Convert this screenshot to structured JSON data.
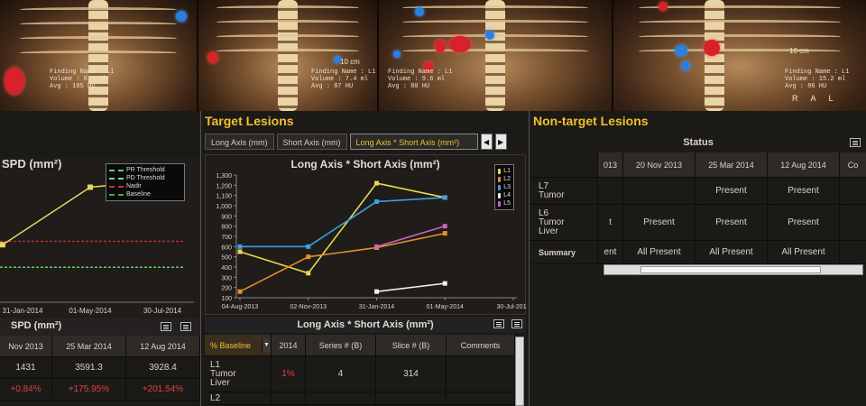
{
  "scans": [
    {
      "finding": "Finding Name : L1",
      "volume": "Volume : 6.5 ml",
      "avg": "Avg : 195 HU",
      "scale": "10 cm",
      "orient": "R A L"
    },
    {
      "finding": "Finding Name : L1",
      "volume": "Volume : 7.4 ml",
      "avg": "Avg : 87 HU",
      "scale": "10 cm",
      "orient": "R A L"
    },
    {
      "finding": "Finding Name : L1",
      "volume": "Volume : 9.6 ml",
      "avg": "Avg : 80 HU",
      "scale": "10 cm",
      "orient": "R A L"
    },
    {
      "finding": "Finding Name : L1",
      "volume": "Volume : 15.2 ml",
      "avg": "Avg : 86 HU",
      "scale": "10 cm",
      "orient": "R A L"
    }
  ],
  "left_panel": {
    "chart_title": "SPD (mm²)",
    "legend": [
      "PR Threshold",
      "PD Threshold",
      "Nadir",
      "Baseline"
    ],
    "x_ticks": [
      "31-Jan-2014",
      "01-May-2014",
      "30-Jul-2014"
    ],
    "table_title": "SPD (mm²)",
    "headers": [
      "Nov 2013",
      "25 Mar 2014",
      "12 Aug 2014"
    ],
    "row_values": [
      "1431",
      "3591.3",
      "3928.4"
    ],
    "row_pct": [
      "+0.84%",
      "+175.95%",
      "+201.54%"
    ]
  },
  "mid_panel": {
    "title": "Target Lesions",
    "tabs": [
      "Long Axis (mm)",
      "Short Axis (mm)",
      "Long Axis * Short Axis (mm²)"
    ],
    "subbar_title": "Long Axis * Short Axis (mm²)",
    "table_headers": [
      "% Baseline",
      "2014",
      "Series # (B)",
      "Slice # (B)",
      "Comments"
    ],
    "row1": {
      "label": "L1\nTumor\nLiver",
      "pct": "1%",
      "series": "4",
      "slice": "314"
    },
    "row2_label": "L2"
  },
  "right_panel": {
    "title": "Non-target Lesions",
    "status_label": "Status",
    "headers": [
      "013",
      "20 Nov 2013",
      "25 Mar 2014",
      "12 Aug 2014",
      "Co"
    ],
    "rows": [
      {
        "label": "L7\nTumor",
        "values": [
          "",
          "",
          "Present",
          "Present",
          ""
        ]
      },
      {
        "label": "L6\nTumor\nLiver",
        "values": [
          "t",
          "Present",
          "Present",
          "Present",
          ""
        ]
      },
      {
        "label": "Summary",
        "values": [
          "ent",
          "All Present",
          "All Present",
          "All Present",
          ""
        ]
      }
    ]
  },
  "chart_data": [
    {
      "type": "line",
      "title": "SPD (mm²)",
      "x": [
        "31-Jan-2014",
        "01-May-2014",
        "30-Jul-2014"
      ],
      "series": [
        {
          "name": "Baseline",
          "color": "#6c6",
          "values": [
            [
              0,
              310
            ],
            [
              1,
              310
            ],
            [
              2,
              310
            ]
          ]
        },
        {
          "name": "Nadir",
          "color": "#b03030",
          "values": [
            [
              0,
              540
            ],
            [
              1,
              540
            ],
            [
              2,
              540
            ]
          ]
        },
        {
          "name": "SPD",
          "color": "#e0d860",
          "values": [
            [
              0,
              510
            ],
            [
              1,
              1020
            ],
            [
              2,
              1080
            ]
          ]
        }
      ],
      "legend_position": "top-right"
    },
    {
      "type": "line",
      "title": "Long Axis * Short Axis (mm²)",
      "x": [
        "04-Aug-2013",
        "02-Nov-2013",
        "31-Jan-2014",
        "01-May-2014",
        "30-Jul-2014"
      ],
      "ylim": [
        100,
        1300
      ],
      "yticks": [
        100,
        200,
        300,
        400,
        500,
        600,
        700,
        800,
        900,
        1000,
        1100,
        1200,
        1300
      ],
      "series": [
        {
          "name": "L1",
          "color": "#e8d84a",
          "values": [
            [
              0,
              550
            ],
            [
              1,
              340
            ],
            [
              2,
              1220
            ],
            [
              3,
              1080
            ]
          ]
        },
        {
          "name": "L2",
          "color": "#e0902a",
          "values": [
            [
              0,
              160
            ],
            [
              1,
              500
            ],
            [
              2,
              590
            ],
            [
              3,
              730
            ]
          ]
        },
        {
          "name": "L3",
          "color": "#3aa0e0",
          "values": [
            [
              0,
              600
            ],
            [
              1,
              600
            ],
            [
              2,
              1040
            ],
            [
              3,
              1080
            ]
          ]
        },
        {
          "name": "L4",
          "color": "#f0f0f0",
          "values": [
            [
              2,
              160
            ],
            [
              3,
              240
            ]
          ]
        },
        {
          "name": "L5",
          "color": "#d060c0",
          "values": [
            [
              2,
              600
            ],
            [
              3,
              800
            ]
          ]
        }
      ],
      "legend_position": "top-right"
    }
  ]
}
